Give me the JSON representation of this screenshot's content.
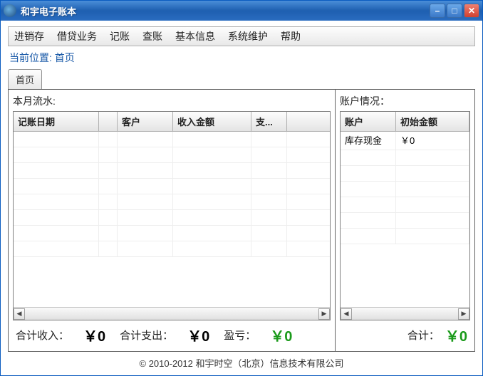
{
  "window": {
    "title": "和宇电子账本"
  },
  "menu": [
    "进销存",
    "借贷业务",
    "记账",
    "查账",
    "基本信息",
    "系统维护",
    "帮助"
  ],
  "breadcrumb": {
    "label": "当前位置:",
    "value": "首页"
  },
  "tabs": [
    {
      "label": "首页"
    }
  ],
  "leftPanel": {
    "title": "本月流水:",
    "columns": [
      "记账日期",
      "",
      "客户",
      "收入金额",
      "支..."
    ],
    "rows": []
  },
  "rightPanel": {
    "title": "账户情况：",
    "columns": [
      "账户",
      "初始金额"
    ],
    "rows": [
      {
        "account": "库存现金",
        "amount": "￥0"
      }
    ]
  },
  "totals": {
    "incomeLabel": "合计收入：",
    "incomeValue": "￥0",
    "expenseLabel": "合计支出：",
    "expenseValue": "￥0",
    "profitLabel": "盈亏：",
    "profitValue": "￥0",
    "sumLabel": "合计：",
    "sumValue": "￥0"
  },
  "footer": "© 2010-2012  和宇时空（北京）信息技术有限公司"
}
